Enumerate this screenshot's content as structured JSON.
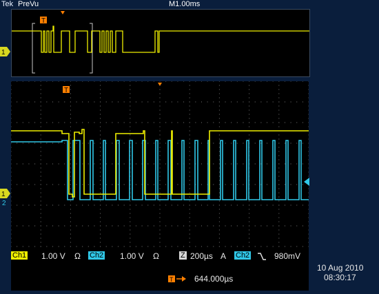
{
  "header": {
    "brand": "Tek",
    "mode": "PreVu",
    "timebase": "M1.00ms"
  },
  "markers": {
    "trigger_symbol": "T",
    "ch1": "1",
    "ch2": "2"
  },
  "status": {
    "ch1_label": "Ch1",
    "ch1_scale": "1.00 V",
    "ch2_label": "Ch2",
    "ch2_scale": "1.00 V",
    "ohm_icon": "Ω",
    "zoom_letter": "Z",
    "zoom_scale": "200µs",
    "acq_letter": "A",
    "trigger_source": "Ch2",
    "trigger_slope_icon": "falling-edge-icon",
    "trigger_level": "980mV",
    "position": "644.000µs",
    "date": "10 Aug 2010",
    "time": "08:30:17"
  },
  "colors": {
    "ch1": "#f0f000",
    "ch2": "#30c8e8",
    "trigger": "#ff8000",
    "background": "#0a1e3c"
  }
}
